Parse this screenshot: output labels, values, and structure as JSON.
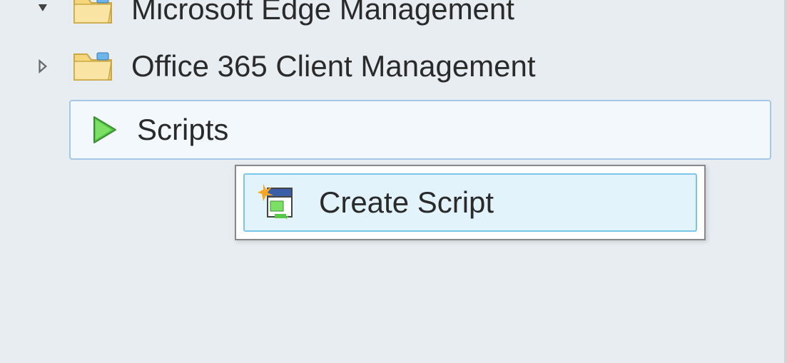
{
  "tree": {
    "items": [
      {
        "label": "Microsoft Edge Management",
        "expandable": true,
        "expanded": true
      },
      {
        "label": "Office 365 Client Management",
        "expandable": true,
        "expanded": false
      },
      {
        "label": "Scripts",
        "selected": true
      }
    ]
  },
  "contextMenu": {
    "items": [
      {
        "label": "Create Script"
      }
    ]
  }
}
